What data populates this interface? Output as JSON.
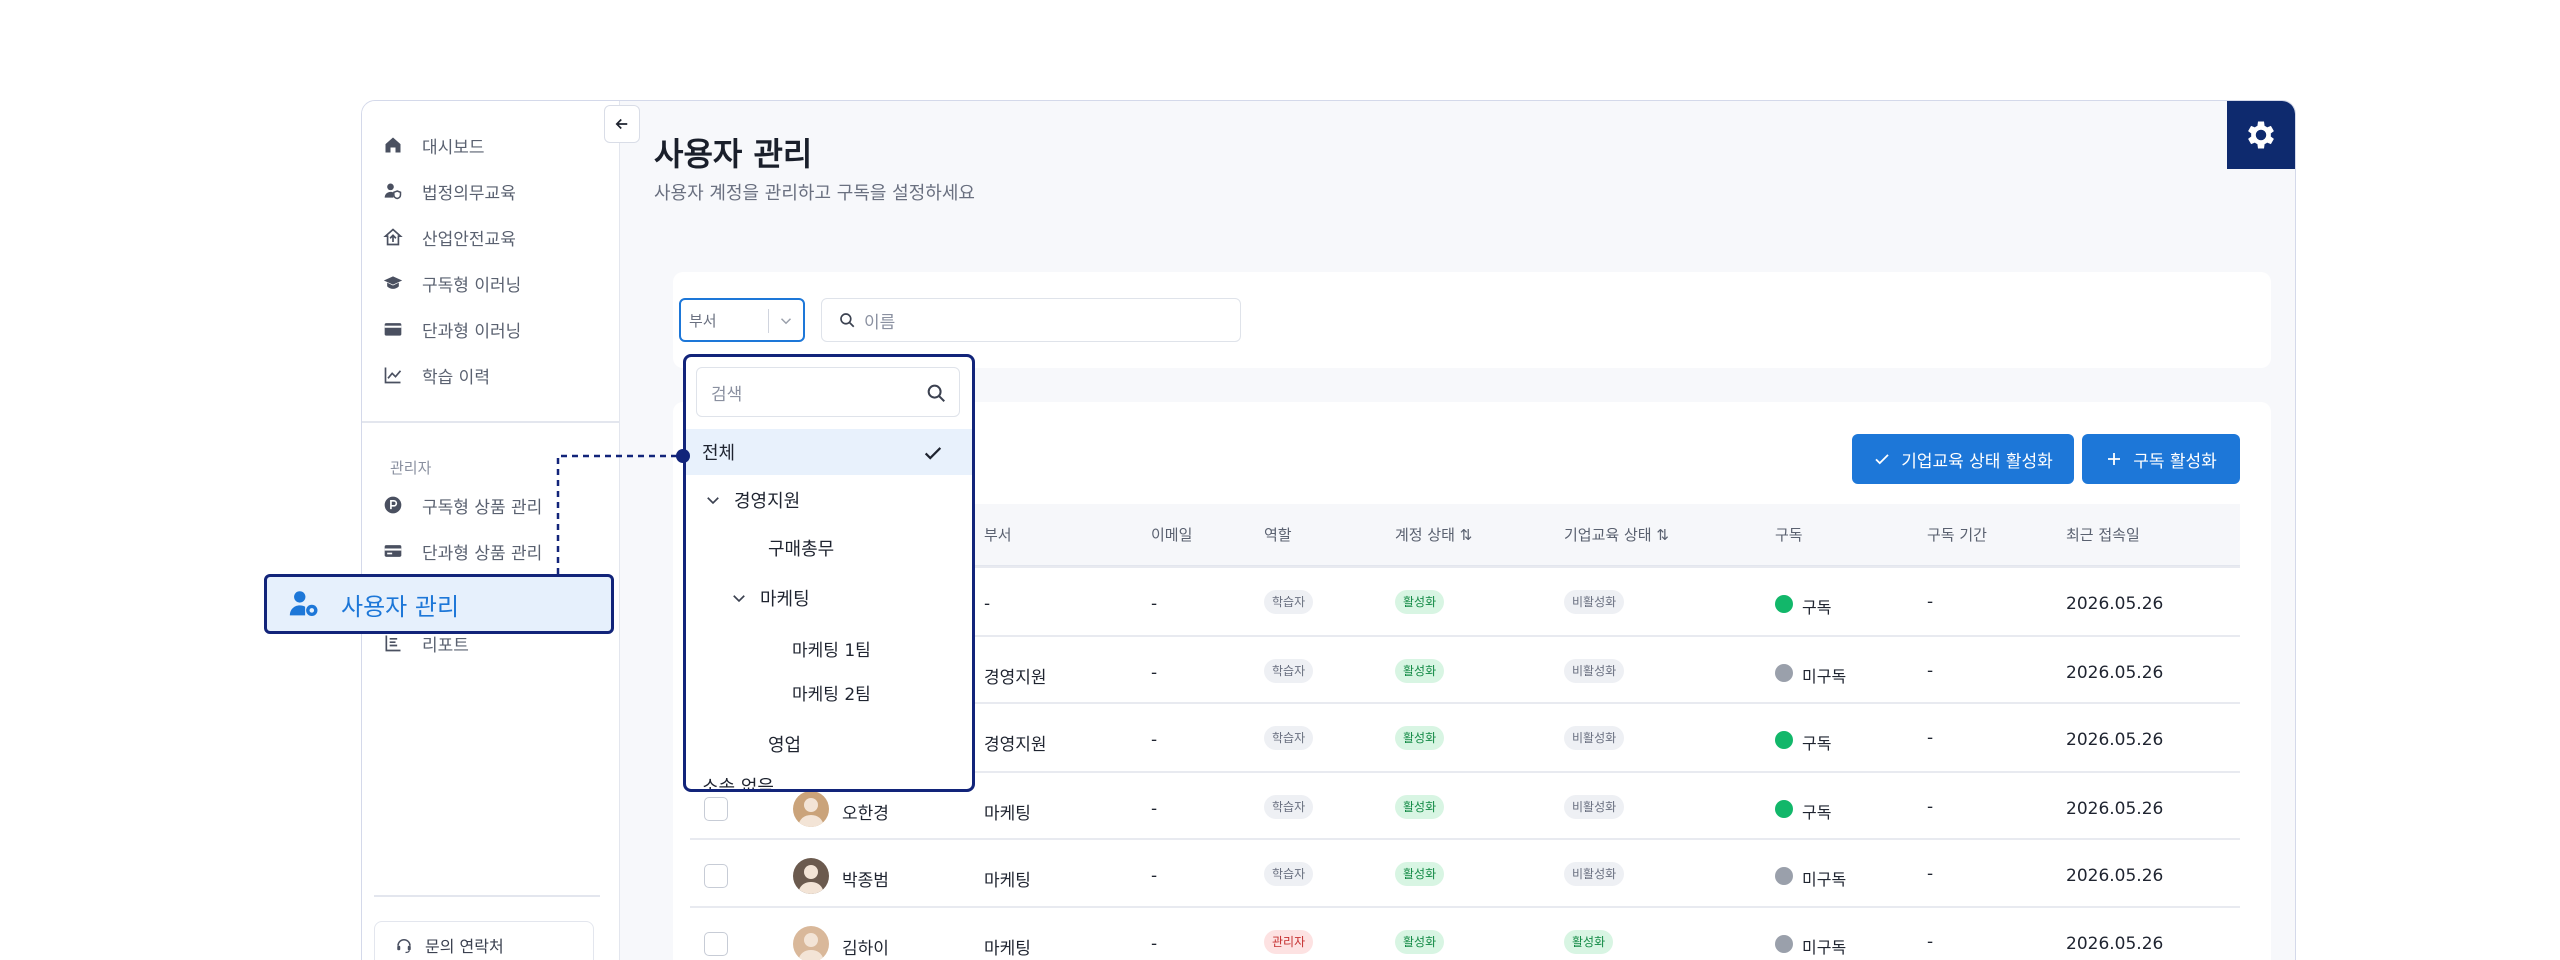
{
  "sidebar": {
    "items": [
      {
        "label": "대시보드",
        "icon": "home-icon"
      },
      {
        "label": "법정의무교육",
        "icon": "user-shield-icon"
      },
      {
        "label": "산업안전교육",
        "icon": "house-up-icon"
      },
      {
        "label": "구독형 이러닝",
        "icon": "graduation-cap-icon"
      },
      {
        "label": "단과형 이러닝",
        "icon": "wallet-icon"
      },
      {
        "label": "학습 이력",
        "icon": "line-chart-icon"
      }
    ],
    "section_label": "관리자",
    "admin_items": [
      {
        "label": "구독형 상품 관리",
        "icon": "p-coin-icon"
      },
      {
        "label": "단과형 상품 관리",
        "icon": "card-icon"
      },
      {
        "label": "리포트",
        "icon": "report-icon"
      }
    ],
    "contact_label": "문의 연락처"
  },
  "header": {
    "title": "사용자 관리",
    "subtitle": "사용자 계정을 관리하고 구독을 설정하세요"
  },
  "filters": {
    "dept_placeholder": "부서",
    "name_placeholder": "이름"
  },
  "actions": {
    "activate_label": "기업교육 상태 활성화",
    "subscribe_label": "구독 활성화"
  },
  "table": {
    "columns": [
      "부서",
      "이메일",
      "역할",
      "계정 상태 ⇅",
      "기업교육 상태 ⇅",
      "구독",
      "구독 기간",
      "최근 접속일"
    ],
    "rows": [
      {
        "name": "",
        "dept": "-",
        "email": "-",
        "role": "학습자",
        "account": "활성화",
        "edu": "비활성화",
        "sub": "구독",
        "sub_on": true,
        "period": "-",
        "last": "2026.05.26"
      },
      {
        "name": "",
        "dept": "경영지원",
        "email": "-",
        "role": "학습자",
        "account": "활성화",
        "edu": "비활성화",
        "sub": "미구독",
        "sub_on": false,
        "period": "-",
        "last": "2026.05.26"
      },
      {
        "name": "",
        "dept": "경영지원",
        "email": "-",
        "role": "학습자",
        "account": "활성화",
        "edu": "비활성화",
        "sub": "구독",
        "sub_on": true,
        "period": "-",
        "last": "2026.05.26"
      },
      {
        "name": "오한경",
        "dept": "마케팅",
        "email": "-",
        "role": "학습자",
        "account": "활성화",
        "edu": "비활성화",
        "sub": "구독",
        "sub_on": true,
        "period": "-",
        "last": "2026.05.26"
      },
      {
        "name": "박종범",
        "dept": "마케팅",
        "email": "-",
        "role": "학습자",
        "account": "활성화",
        "edu": "비활성화",
        "sub": "미구독",
        "sub_on": false,
        "period": "-",
        "last": "2026.05.26"
      },
      {
        "name": "김하이",
        "dept": "마케팅",
        "email": "-",
        "role": "관리자",
        "account": "활성화",
        "edu": "활성화",
        "sub": "미구독",
        "sub_on": false,
        "period": "-",
        "last": "2026.05.26"
      }
    ]
  },
  "dropdown": {
    "search_placeholder": "검색",
    "items": [
      {
        "label": "전체",
        "selected": true
      },
      {
        "label": "경영지원",
        "expanded": true
      },
      {
        "label": "구매총무"
      },
      {
        "label": "마케팅",
        "expanded": true
      },
      {
        "label": "마케팅 1팀"
      },
      {
        "label": "마케팅 2팀"
      },
      {
        "label": "영업"
      },
      {
        "label": "소속 없음"
      }
    ]
  },
  "callout": {
    "label": "사용자 관리",
    "icon": "user-gear-icon"
  },
  "colors": {
    "primary": "#1d77d8",
    "navy": "#12247a",
    "gear_bg": "#0e2a6e",
    "green": "#12b76a"
  }
}
